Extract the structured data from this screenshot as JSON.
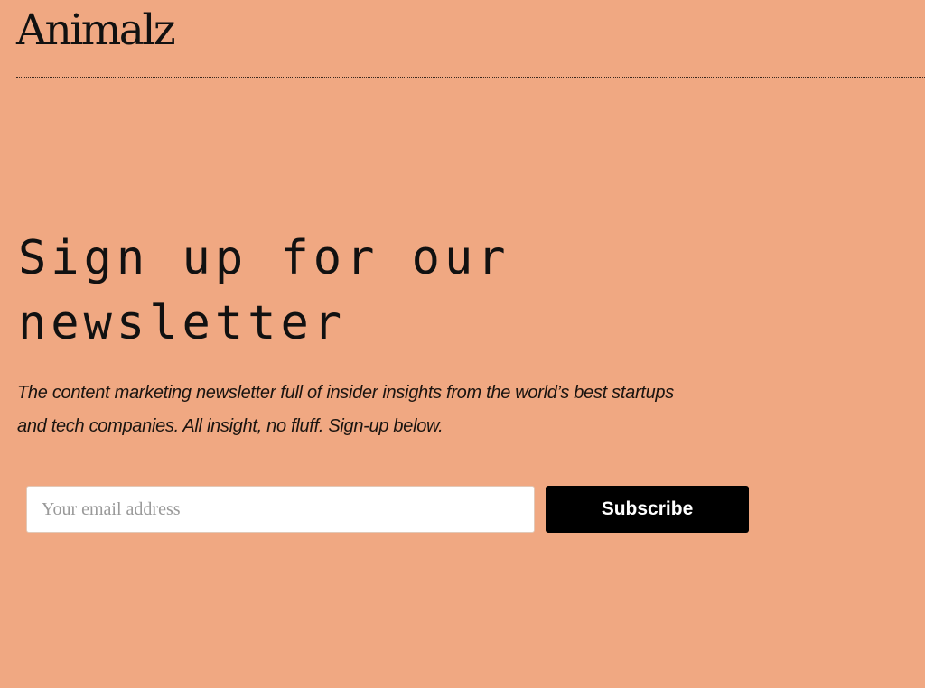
{
  "header": {
    "logo_text": "Animalz"
  },
  "main": {
    "headline_line1": "Sign up for our",
    "headline_line2": "newsletter",
    "subtitle_line1": "The content marketing newsletter full of insider insights from the world’s best startups",
    "subtitle_line2": "and tech companies. All insight, no fluff. Sign-up below."
  },
  "form": {
    "email_placeholder": "Your email address",
    "email_value": "",
    "subscribe_label": "Subscribe"
  },
  "colors": {
    "background": "#F0A882",
    "text": "#111111",
    "button_bg": "#000000",
    "button_text": "#FFFFFF",
    "input_bg": "#FFFFFF"
  }
}
